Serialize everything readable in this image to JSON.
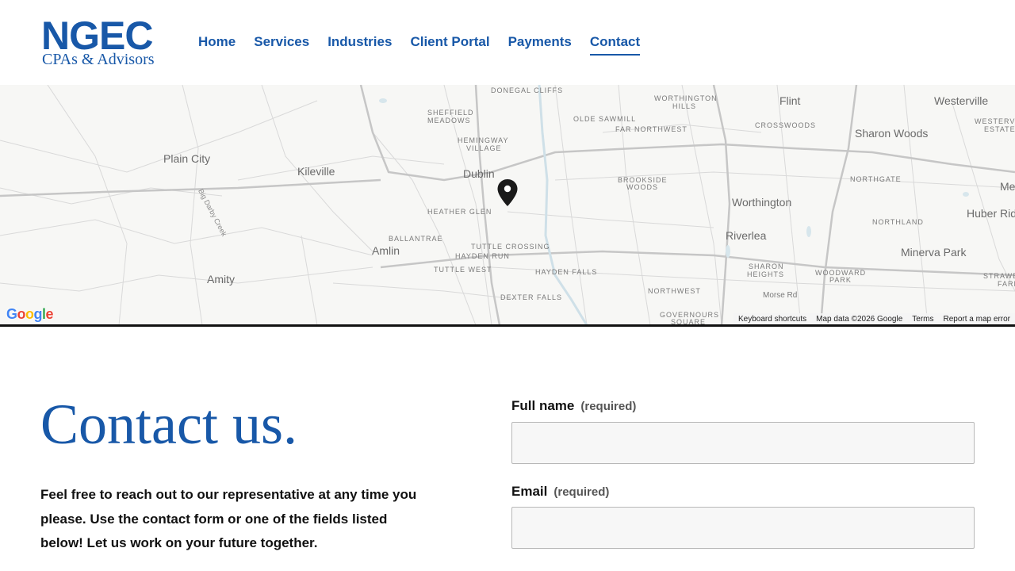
{
  "header": {
    "logo": {
      "main": "NGEC",
      "sub": "CPAs & Advisors"
    },
    "nav": [
      {
        "label": "Home",
        "active": false
      },
      {
        "label": "Services",
        "active": false
      },
      {
        "label": "Industries",
        "active": false
      },
      {
        "label": "Client Portal",
        "active": false
      },
      {
        "label": "Payments",
        "active": false
      },
      {
        "label": "Contact",
        "active": true
      }
    ]
  },
  "map": {
    "labels": {
      "plain_city": "Plain City",
      "kileville": "Kileville",
      "dublin": "Dublin",
      "amlin": "Amlin",
      "amity": "Amity",
      "worthington": "Worthington",
      "riverlea": "Riverlea",
      "flint": "Flint",
      "westerville": "Westerville",
      "sharon_woods": "Sharon Woods",
      "minerva_park": "Minerva Park",
      "huber_ridge": "Huber Rid",
      "me": "Me",
      "donegal_cliffs": "DONEGAL CLIFFS",
      "sheffield_meadows_1": "SHEFFIELD",
      "sheffield_meadows_2": "MEADOWS",
      "hemingway_village_1": "HEMINGWAY",
      "hemingway_village_2": "VILLAGE",
      "olde_sawmill": "OLDE SAWMILL",
      "far_northwest": "FAR NORTHWEST",
      "worthington_hills_1": "WORTHINGTON",
      "worthington_hills_2": "HILLS",
      "crosswoods": "CROSSWOODS",
      "westerville_estates_1": "WESTERVI",
      "westerville_estates_2": "ESTATE",
      "brookside_woods_1": "BROOKSIDE",
      "brookside_woods_2": "WOODS",
      "northgate": "NORTHGATE",
      "heather_glen": "HEATHER GLEN",
      "ballantrae": "BALLANTRAE",
      "tuttle_crossing": "TUTTLE CROSSING",
      "hayden_run": "HAYDEN RUN",
      "tuttle_west": "TUTTLE WEST",
      "hayden_falls": "HAYDEN FALLS",
      "northland": "NORTHLAND",
      "sharon_heights_1": "SHARON",
      "sharon_heights_2": "HEIGHTS",
      "woodward_park_1": "WOODWARD",
      "woodward_park_2": "PARK",
      "strawberry_farms_1": "STRAWE",
      "strawberry_farms_2": "FARM",
      "dexter_falls": "DEXTER FALLS",
      "northwest": "NORTHWEST",
      "governours_square_1": "GOVERNOURS",
      "governours_square_2": "SQUARE",
      "morse_rd": "Morse Rd",
      "big_darby_creek": "Big Darby Creek"
    },
    "footer": {
      "shortcuts": "Keyboard shortcuts",
      "data": "Map data ©2026 Google",
      "terms": "Terms",
      "report": "Report a map error"
    },
    "google_logo": "Google"
  },
  "content": {
    "heading": "Contact us.",
    "intro": "Feel free to reach out to our representative at any time you please. Use the contact form or one of the fields listed below! Let us work on your future together."
  },
  "form": {
    "full_name": {
      "label": "Full name",
      "required_note": "(required)",
      "value": ""
    },
    "email": {
      "label": "Email",
      "required_note": "(required)",
      "value": ""
    }
  },
  "colors": {
    "brand_blue": "#1858a8",
    "text_dark": "#111111",
    "map_bg": "#f7f7f5"
  },
  "icons": {
    "map_pin": "map-pin-icon"
  }
}
